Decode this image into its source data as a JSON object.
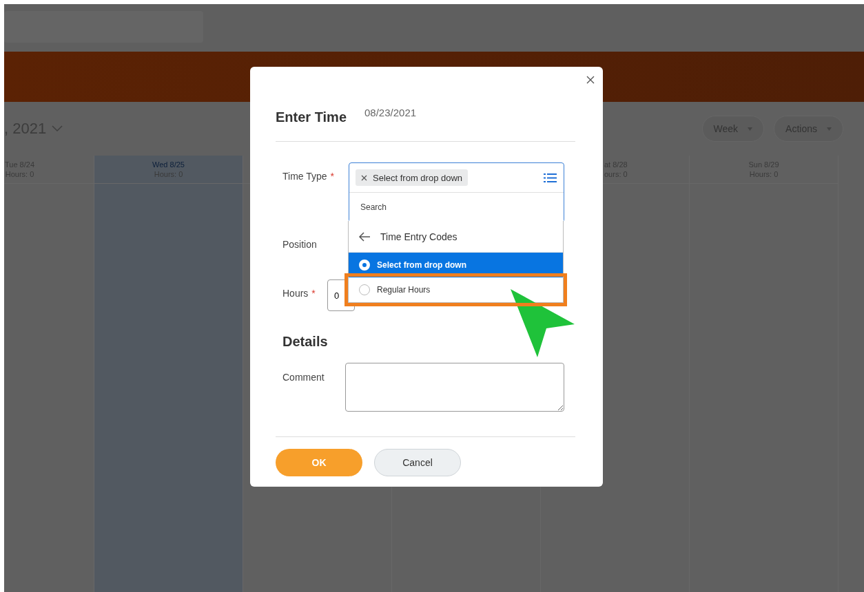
{
  "background": {
    "title_fragment": ", 2021",
    "view_buttons": [
      {
        "label": "Week"
      },
      {
        "label": "Actions"
      }
    ],
    "days": [
      {
        "label": "Tue 8/24",
        "hours": "Hours: 0",
        "selected": false
      },
      {
        "label": "Wed 8/25",
        "hours": "Hours: 0",
        "selected": true
      },
      {
        "label": "at 8/28",
        "hours": "ours: 0",
        "selected": false
      },
      {
        "label": "Sun 8/29",
        "hours": "Hours: 0",
        "selected": false
      }
    ]
  },
  "dialog": {
    "title": "Enter Time",
    "date": "08/23/2021",
    "time_type": {
      "label": "Time Type",
      "required_mark": "*",
      "chip": "Select from drop down",
      "search_placeholder": "Search"
    },
    "dropdown": {
      "header": "Time Entry Codes",
      "options": [
        {
          "label": "Select from drop down",
          "selected": true,
          "highlighted": false
        },
        {
          "label": "Regular Hours",
          "selected": false,
          "highlighted": true
        }
      ]
    },
    "position": {
      "label": "Position"
    },
    "hours": {
      "label": "Hours",
      "required_mark": "*",
      "value": "0"
    },
    "details": {
      "heading": "Details",
      "comment_label": "Comment"
    },
    "buttons": [
      {
        "label": "OK",
        "kind": "primary"
      },
      {
        "label": "Cancel",
        "kind": "secondary"
      }
    ]
  }
}
